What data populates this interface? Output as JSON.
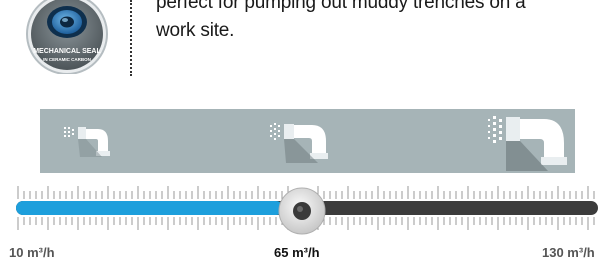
{
  "badge": {
    "line1": "MECHANICAL SEAL",
    "line2": "IN CERAMIC CARBON"
  },
  "description": {
    "line1": "perfect for pumping out muddy trenches on a",
    "line2": "work site."
  },
  "slider": {
    "min_label": "10 m³/h",
    "current_label": "65 m³/h",
    "max_label": "130 m³/h",
    "min": 10,
    "max": 130,
    "value": 65,
    "fill_color": "#1d9fdc",
    "track_color": "#3c3c3c"
  },
  "flow_icons": [
    "low-flow-nozzle-icon",
    "medium-flow-nozzle-icon",
    "high-flow-nozzle-icon"
  ],
  "panel_color": "#a6b4b7"
}
